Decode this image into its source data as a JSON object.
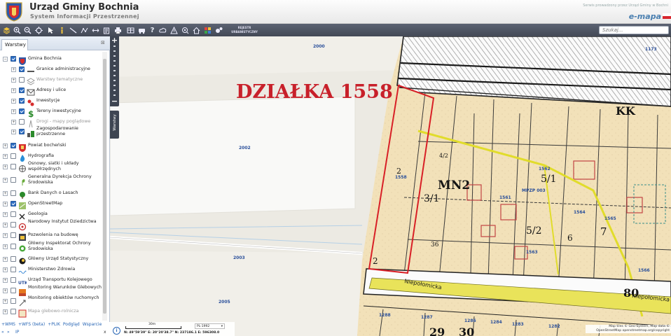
{
  "header": {
    "title": "Urząd Gminy Bochnia",
    "subtitle": "System Informacji Przestrzennej",
    "service_note": "Serwis prowadzony przez Urząd Gminy w Bochni",
    "emapa_logo": "e-mapa"
  },
  "toolbar": {
    "icons": [
      "layers-icon",
      "zoom-in-icon",
      "zoom-out-icon",
      "zoom-extent-icon",
      "select-arrow-icon",
      "info-icon",
      "measure-line-icon",
      "measure-path-icon",
      "pan-icon",
      "identify-icon",
      "print-icon",
      "table-icon",
      "vehicle-icon",
      "help-icon",
      "cloud-icon",
      "warning-icon",
      "search-map-icon",
      "home-icon",
      "tiles-icon",
      "settings-icon"
    ],
    "text_button": "REJESTR URBANISTYCZNY",
    "search_placeholder": "Szukaj..."
  },
  "panel": {
    "tab_label": "Warstwy",
    "items": [
      {
        "label": "Gmina Bochnia",
        "level": 0,
        "checked": true,
        "toggle": "−",
        "icon": "gmina-crest-icon"
      },
      {
        "label": "Granice administracyjne",
        "level": 1,
        "checked": true,
        "toggle": "+",
        "icon": "boundary-icon"
      },
      {
        "label": "Warstwy tematyczne",
        "level": 1,
        "checked": false,
        "toggle": "+",
        "icon": "thematic-layers-icon",
        "dim": true
      },
      {
        "label": "Adresy i ulice",
        "level": 1,
        "checked": true,
        "toggle": "+",
        "icon": "address-icon"
      },
      {
        "label": "Inwestycje",
        "level": 1,
        "checked": true,
        "toggle": "+",
        "icon": "investment-icon"
      },
      {
        "label": "Tereny inwestycyjne",
        "level": 1,
        "checked": true,
        "toggle": "+",
        "icon": "dollar-icon"
      },
      {
        "label": "Drogi - mapy poglądowe",
        "level": 1,
        "checked": false,
        "toggle": "+",
        "icon": "roads-icon",
        "dim": true
      },
      {
        "label": "Zagospodarowanie przestrzenne",
        "level": 1,
        "checked": true,
        "toggle": "+",
        "icon": "zoning-icon"
      },
      {
        "label": "Powiat bocheński",
        "level": 0,
        "checked": true,
        "toggle": "+",
        "icon": "powiat-crest-icon"
      },
      {
        "label": "Hydrografia",
        "level": 0,
        "checked": false,
        "toggle": "+",
        "icon": "water-drop-icon"
      },
      {
        "label": "Osnowy, siatki i układy współrzędnych",
        "level": 0,
        "checked": false,
        "toggle": "+",
        "icon": "globe-icon"
      },
      {
        "label": "Generalna Dyrekcja Ochrony Środowiska",
        "level": 0,
        "checked": false,
        "toggle": "+",
        "icon": "leaf-icon"
      },
      {
        "label": "Bank Danych o Lasach",
        "level": 0,
        "checked": false,
        "toggle": "+",
        "icon": "tree-icon"
      },
      {
        "label": "OpenStreetMap",
        "level": 0,
        "checked": true,
        "toggle": "+",
        "icon": "osm-icon"
      },
      {
        "label": "Geologia",
        "level": 0,
        "checked": false,
        "toggle": "+",
        "icon": "hammers-icon"
      },
      {
        "label": "Narodowy Instytut Dziedzictwa",
        "level": 0,
        "checked": false,
        "toggle": "+",
        "icon": "heritage-icon"
      },
      {
        "label": "Pozwolenia na budowę",
        "level": 0,
        "checked": false,
        "toggle": "+",
        "icon": "permit-icon"
      },
      {
        "label": "Główny Inspektorat Ochrony Środowiska",
        "level": 0,
        "checked": false,
        "toggle": "+",
        "icon": "gios-icon"
      },
      {
        "label": "Główny Urząd Statystyczny",
        "level": 0,
        "checked": false,
        "toggle": "+",
        "icon": "gus-icon"
      },
      {
        "label": "Ministerstwo Zdrowia",
        "level": 0,
        "checked": false,
        "toggle": "+",
        "icon": "health-wave-icon"
      },
      {
        "label": "Urząd Transportu Kolejowego",
        "level": 0,
        "checked": false,
        "toggle": "+",
        "icon": "utk-icon"
      },
      {
        "label": "Monitoring Warunków Glebowych",
        "level": 0,
        "checked": false,
        "toggle": "+",
        "icon": "soil-monitor-icon"
      },
      {
        "label": "Monitoring obiektów ruchomych",
        "level": 0,
        "checked": false,
        "toggle": "+",
        "icon": "moving-objects-icon"
      },
      {
        "label": "Mapa glebowo-rolnicza",
        "level": 0,
        "checked": false,
        "toggle": "+",
        "icon": "soil-map-icon",
        "dim": true
      }
    ],
    "bottom_links": [
      "+WMS",
      "+WFS (beta)",
      "+PLIK",
      "Podgląd",
      "Wsparcie"
    ],
    "bottom_nav": {
      "prev": "«",
      "next": "»",
      "ip": "IP",
      "close": "x"
    }
  },
  "map": {
    "parcel_heading": "DZIAŁKA 1558",
    "parcel_labels": [
      "2000",
      "2002",
      "2003",
      "2005",
      "1173",
      "1558",
      "1562",
      "1561",
      "MPZP 003",
      "1564",
      "1565",
      "1566",
      "1563",
      "1283",
      "1286",
      "1287",
      "1284",
      "1288",
      "1282"
    ],
    "street_labels": [
      "Niepołomicka",
      "Niepołomicka"
    ],
    "handwritten_labels": [
      "KK",
      "MN2",
      "2",
      "3/1",
      "5/1",
      "5/2",
      "7",
      "6",
      "80",
      "29",
      "30",
      "2",
      "36",
      "4/2"
    ],
    "side_tab_label": "Warstwy"
  },
  "status": {
    "scale_label": "30m",
    "crs": "PL-1992",
    "coords": "N: 49°59'39\"   E: 20°20'38.7\"  N: 237186.1   E: 596308.0",
    "attribution": "Map tiles © Geo-System, Map data © OpenStreetMap openstreetmap.org/copyright"
  },
  "colors": {
    "toolbar": "#4e5563",
    "parcel_outline": "#d81f26",
    "heading_red": "#c8202a",
    "street_yellow": "#e9e35a",
    "cadastral_fill": "#f2e2bc",
    "osm_fill": "#f1efe9",
    "link_blue": "#2866b5"
  }
}
